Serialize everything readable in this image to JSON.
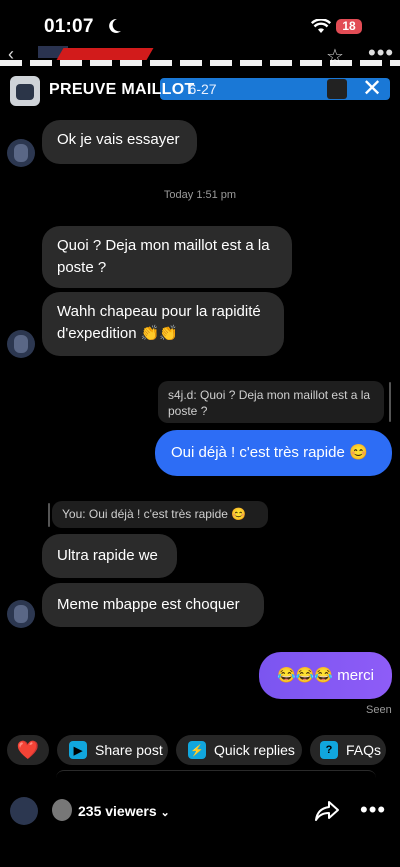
{
  "status_bar": {
    "time": "01:07",
    "battery": "18"
  },
  "header": {
    "title": "PREUVE MAILLOT",
    "banner_text": "· 6-27"
  },
  "messages": [
    {
      "side": "in",
      "text": "Ok je vais essayer"
    },
    {
      "side": "in",
      "text": "Quoi ? Deja mon maillot est a la poste ?"
    },
    {
      "side": "in",
      "text": "Wahh chapeau pour la rapidité d'expedition 👏👏"
    },
    {
      "side": "out",
      "quote": "s4j.d: Quoi ? Deja mon maillot est a la poste ?",
      "text": "Oui déjà ! c'est très rapide 😊"
    },
    {
      "side": "in",
      "quote": "You: Oui déjà ! c'est très rapide 😊",
      "text": "Ultra rapide we"
    },
    {
      "side": "in",
      "text": "Meme mbappe est choquer"
    },
    {
      "side": "out",
      "text": "😂😂😂 merci"
    }
  ],
  "timestamp": "Today 1:51 pm",
  "seen": "Seen",
  "actions": {
    "heart": "❤️",
    "share_post": "Share post",
    "quick_replies": "Quick replies",
    "faqs": "FAQs"
  },
  "bottom": {
    "viewers": "235 viewers"
  },
  "colors": {
    "accent_blue": "#2d6df5",
    "purple": "#8e5cf7",
    "battery_red": "#e24c55"
  }
}
